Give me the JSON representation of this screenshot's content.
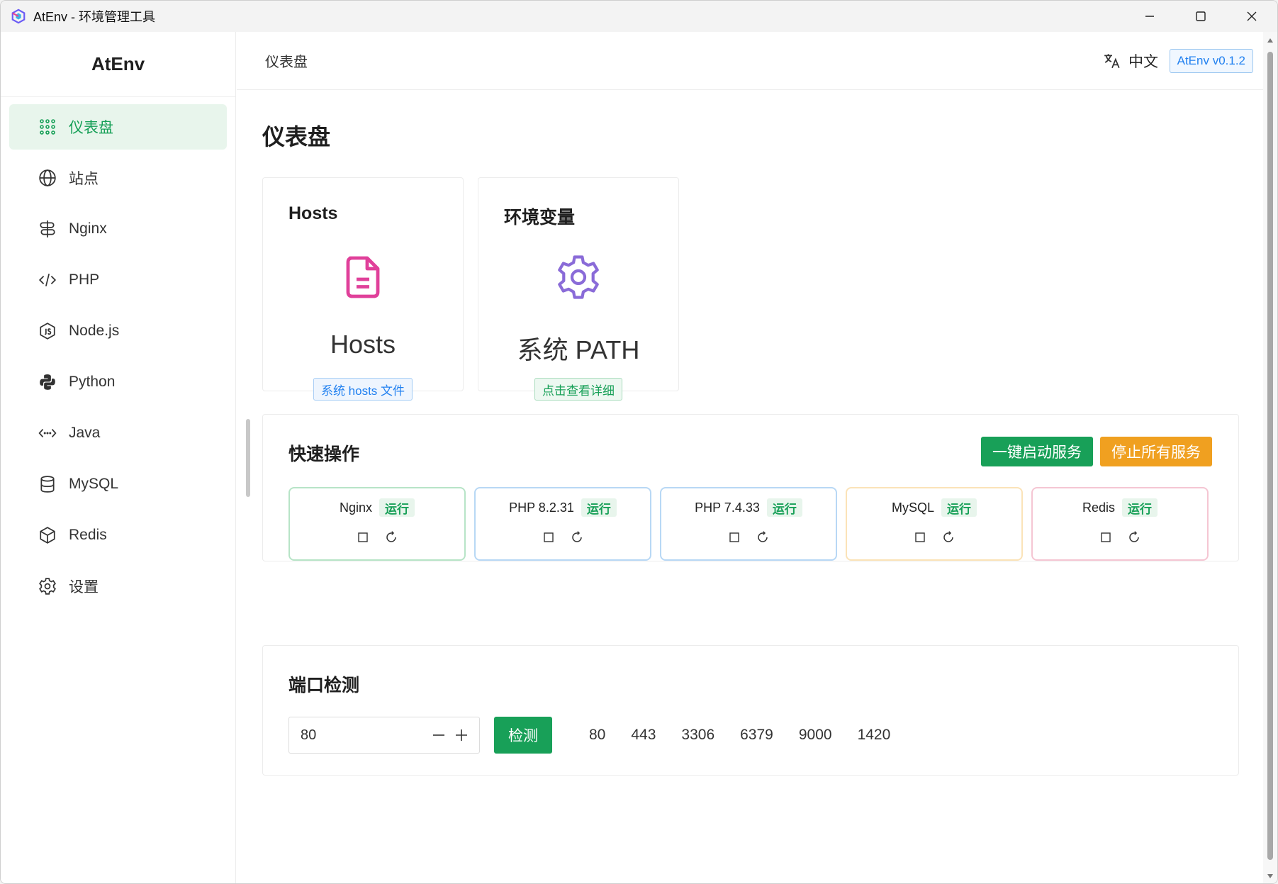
{
  "window": {
    "title": "AtEnv - 环境管理工具"
  },
  "sidebar": {
    "brand": "AtEnv",
    "items": [
      {
        "label": "仪表盘",
        "icon": "dashboard-grid-icon",
        "active": true
      },
      {
        "label": "站点",
        "icon": "globe-icon"
      },
      {
        "label": "Nginx",
        "icon": "signpost-icon"
      },
      {
        "label": "PHP",
        "icon": "code-icon"
      },
      {
        "label": "Node.js",
        "icon": "nodejs-icon"
      },
      {
        "label": "Python",
        "icon": "python-icon"
      },
      {
        "label": "Java",
        "icon": "code-dots-icon"
      },
      {
        "label": "MySQL",
        "icon": "database-icon"
      },
      {
        "label": "Redis",
        "icon": "cube-icon"
      },
      {
        "label": "设置",
        "icon": "gear-icon"
      }
    ]
  },
  "header": {
    "breadcrumb": "仪表盘",
    "language": "中文",
    "version": "AtEnv v0.1.2"
  },
  "page": {
    "title": "仪表盘"
  },
  "cards": {
    "hosts": {
      "title": "Hosts",
      "main_text": "Hosts",
      "tag": "系统 hosts 文件"
    },
    "env": {
      "title": "环境变量",
      "main_text": "系统 PATH",
      "tag": "点击查看详细"
    }
  },
  "quick": {
    "title": "快速操作",
    "start_all": "一键启动服务",
    "stop_all": "停止所有服务",
    "services": [
      {
        "name": "Nginx",
        "status": "运行",
        "border": "#b7e4c7"
      },
      {
        "name": "PHP 8.2.31",
        "status": "运行",
        "border": "#b8d8f5"
      },
      {
        "name": "PHP 7.4.33",
        "status": "运行",
        "border": "#b8d8f5"
      },
      {
        "name": "MySQL",
        "status": "运行",
        "border": "#fbe3b8"
      },
      {
        "name": "Redis",
        "status": "运行",
        "border": "#f5c6d3"
      }
    ]
  },
  "ports": {
    "title": "端口检测",
    "value": "80",
    "check_label": "检测",
    "quick_ports": [
      "80",
      "443",
      "3306",
      "6379",
      "9000",
      "1420"
    ]
  },
  "colors": {
    "primary": "#18a058",
    "warning": "#f0a020",
    "info": "#2080f0"
  }
}
